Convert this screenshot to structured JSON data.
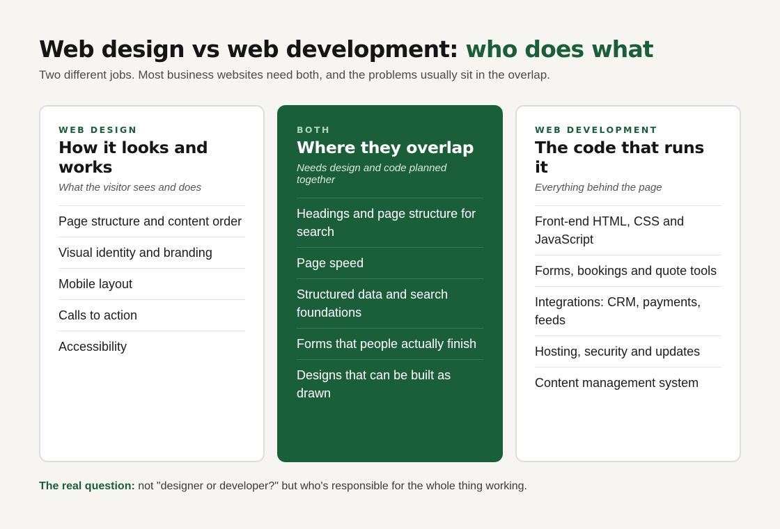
{
  "header": {
    "title_main": "Web design vs web development: ",
    "title_accent": "who does what",
    "subtitle": "Two different jobs. Most business websites need both, and the problems usually sit in the overlap."
  },
  "cards": [
    {
      "eyebrow": "WEB DESIGN",
      "title": "How it looks and works",
      "subtitle": "What the visitor sees and does",
      "items": [
        "Page structure and content order",
        "Visual identity and branding",
        "Mobile layout",
        "Calls to action",
        "Accessibility"
      ]
    },
    {
      "eyebrow": "BOTH",
      "title": "Where they overlap",
      "subtitle": "Needs design and code planned together",
      "items": [
        "Headings and page structure for search",
        "Page speed",
        "Structured data and search foundations",
        "Forms that people actually finish",
        "Designs that can be built as drawn"
      ]
    },
    {
      "eyebrow": "WEB DEVELOPMENT",
      "title": "The code that runs it",
      "subtitle": "Everything behind the page",
      "items": [
        "Front-end HTML, CSS and JavaScript",
        "Forms, bookings and quote tools",
        "Integrations: CRM, payments, feeds",
        "Hosting, security and updates",
        "Content management system"
      ]
    }
  ],
  "footer": {
    "lead": "The real question:",
    "text": " not \"designer or developer?\" but who's responsible for the whole thing working."
  },
  "colors": {
    "accent": "#1b5e3a",
    "background": "#f6f5f2",
    "card": "#ffffff"
  }
}
